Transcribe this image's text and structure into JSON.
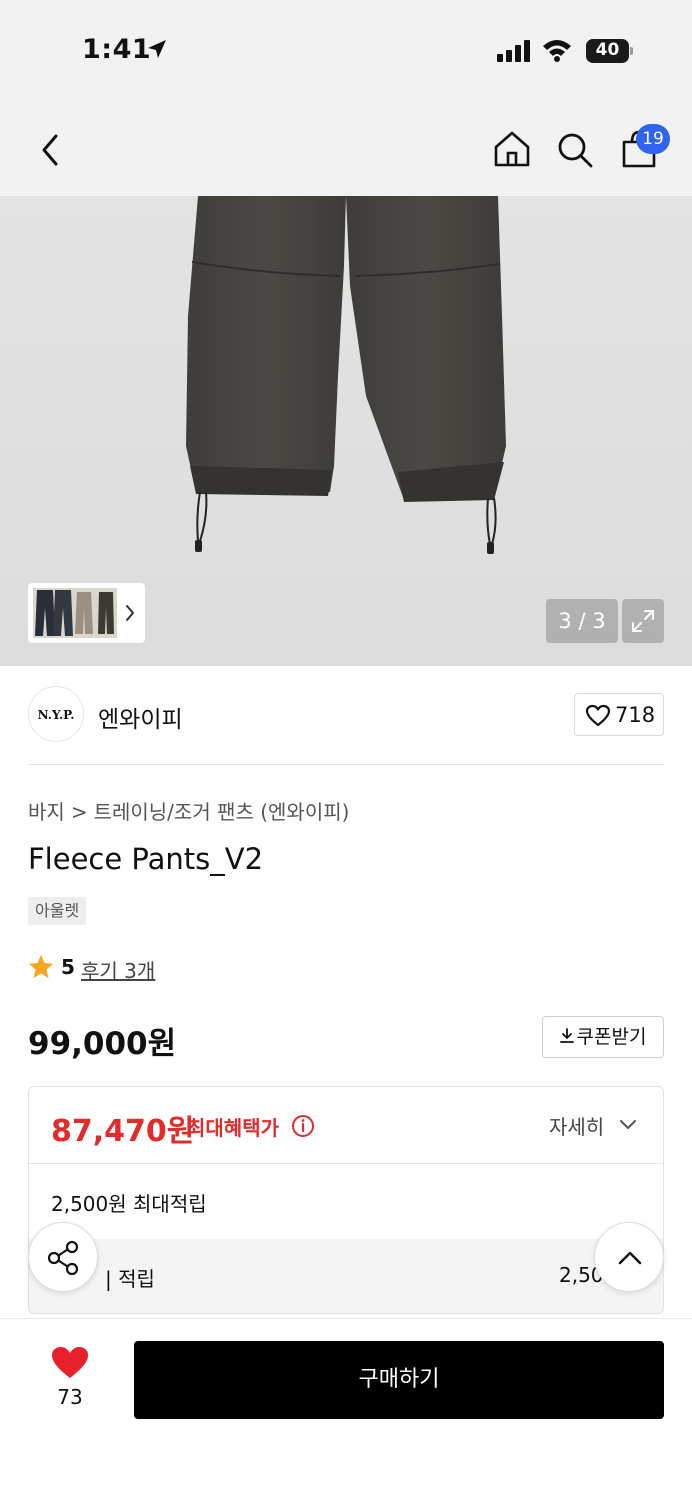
{
  "status_bar": {
    "time": "1:41",
    "battery": "40"
  },
  "nav": {
    "cart_count": "19"
  },
  "gallery": {
    "counter": "3 / 3"
  },
  "brand": {
    "logo_text": "N.Y.P.",
    "name": "엔와이피",
    "likes": "718"
  },
  "breadcrumb": {
    "category": "바지",
    "separator": ">",
    "subcategory": "트레이닝/조거 팬츠 (엔와이피)"
  },
  "product": {
    "title": "Fleece Pants_V2",
    "tag": "아울렛",
    "rating": "5",
    "reviews": "후기 3개",
    "price": "99,000원",
    "coupon_label": "쿠폰받기",
    "coupon_icon": "download-icon"
  },
  "benefit": {
    "sale_price": "87,470원",
    "sale_label": "최대혜택가",
    "detail_label": "자세히",
    "points_summary": "2,500원 최대적립",
    "points_row_label": "| 적립",
    "points_row_value": "2,50"
  },
  "bottom_bar": {
    "like_count": "73",
    "buy_label": "구매하기"
  },
  "colors": {
    "accent_red": "#e32b2b",
    "badge_blue": "#2f63f0",
    "button_black": "#000000"
  }
}
